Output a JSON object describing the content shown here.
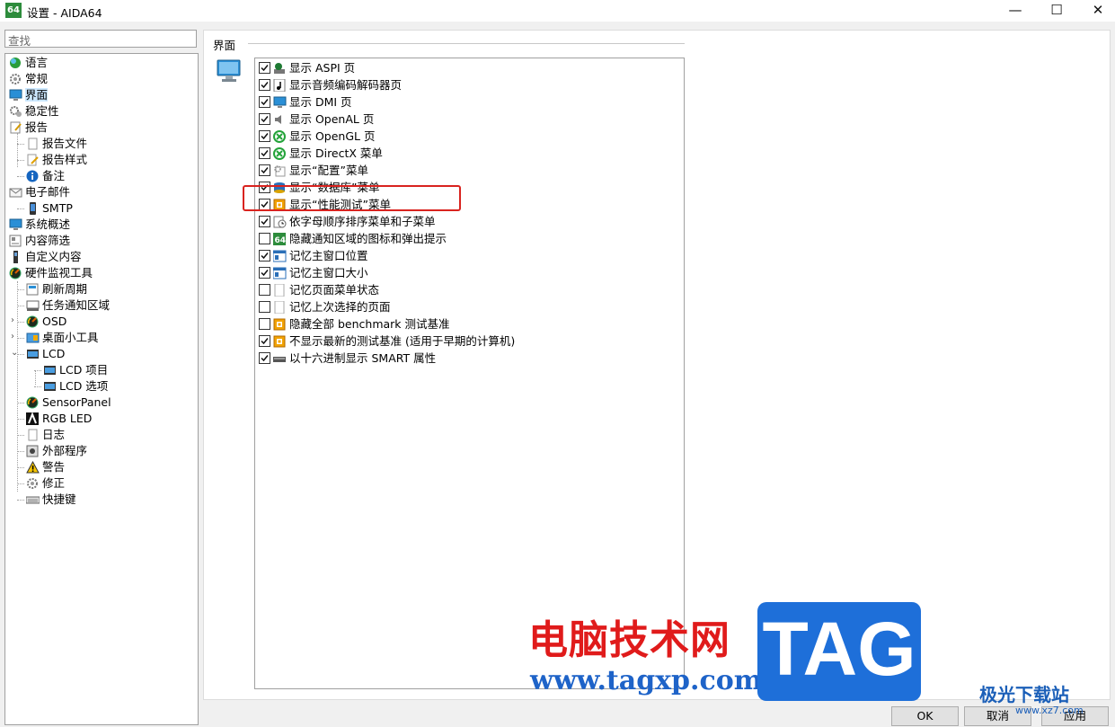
{
  "window": {
    "app_icon": "64",
    "title": "设置 - AIDA64",
    "controls": [
      "—",
      "☐",
      "✕"
    ]
  },
  "search": {
    "placeholder": "查找"
  },
  "tree": [
    {
      "label": "语言",
      "icon": "globe-icon",
      "level": 0
    },
    {
      "label": "常规",
      "icon": "gear-icon",
      "level": 0
    },
    {
      "label": "界面",
      "icon": "monitor-icon",
      "level": 0,
      "selected": true
    },
    {
      "label": "稳定性",
      "icon": "gears-icon",
      "level": 0
    },
    {
      "label": "报告",
      "icon": "report-icon",
      "level": 0
    },
    {
      "label": "报告文件",
      "icon": "file-icon",
      "level": 1
    },
    {
      "label": "报告样式",
      "icon": "pencil-file-icon",
      "level": 1
    },
    {
      "label": "备注",
      "icon": "info-icon",
      "level": 1
    },
    {
      "label": "电子邮件",
      "icon": "mail-icon",
      "level": 0
    },
    {
      "label": "SMTP",
      "icon": "phone-icon",
      "level": 1
    },
    {
      "label": "系统概述",
      "icon": "monitor-icon",
      "level": 0
    },
    {
      "label": "内容筛选",
      "icon": "filter-icon",
      "level": 0
    },
    {
      "label": "自定义内容",
      "icon": "device-icon",
      "level": 0
    },
    {
      "label": "硬件监视工具",
      "icon": "gauge-icon",
      "level": 0
    },
    {
      "label": "刷新周期",
      "icon": "refresh-icon",
      "level": 1
    },
    {
      "label": "任务通知区域",
      "icon": "tray-icon",
      "level": 1
    },
    {
      "label": "OSD",
      "icon": "gauge-icon",
      "level": 1,
      "expander": "›"
    },
    {
      "label": "桌面小工具",
      "icon": "widget-icon",
      "level": 1,
      "expander": "›"
    },
    {
      "label": "LCD",
      "icon": "lcd-icon",
      "level": 1,
      "expander": "⌄"
    },
    {
      "label": "LCD 项目",
      "icon": "lcd-icon",
      "level": 2
    },
    {
      "label": "LCD 选项",
      "icon": "lcd-icon",
      "level": 2
    },
    {
      "label": "SensorPanel",
      "icon": "gauge-icon",
      "level": 1
    },
    {
      "label": "RGB LED",
      "icon": "rgb-icon",
      "level": 1
    },
    {
      "label": "日志",
      "icon": "file-icon",
      "level": 1
    },
    {
      "label": "外部程序",
      "icon": "program-icon",
      "level": 1
    },
    {
      "label": "警告",
      "icon": "warning-icon",
      "level": 1
    },
    {
      "label": "修正",
      "icon": "gear-icon",
      "level": 1
    },
    {
      "label": "快捷键",
      "icon": "keyboard-icon",
      "level": 1
    }
  ],
  "section": {
    "title": "界面"
  },
  "options": [
    {
      "label": "显示 ASPI 页",
      "checked": true,
      "icon": "aspi-icon"
    },
    {
      "label": "显示音频编码解码器页",
      "checked": true,
      "icon": "music-icon"
    },
    {
      "label": "显示 DMI 页",
      "checked": true,
      "icon": "monitor-icon"
    },
    {
      "label": "显示 OpenAL 页",
      "checked": true,
      "icon": "speaker-icon"
    },
    {
      "label": "显示 OpenGL 页",
      "checked": true,
      "icon": "xbox-icon"
    },
    {
      "label": "显示 DirectX 菜单",
      "checked": true,
      "icon": "xbox-icon"
    },
    {
      "label": "显示“配置”菜单",
      "checked": true,
      "icon": "config-icon"
    },
    {
      "label": "显示“数据库”菜单",
      "checked": true,
      "icon": "database-icon"
    },
    {
      "label": "显示“性能测试”菜单",
      "checked": true,
      "icon": "benchmark-icon"
    },
    {
      "label": "依字母顺序排序菜单和子菜单",
      "checked": true,
      "icon": "sort-icon"
    },
    {
      "label": "隐藏通知区域的图标和弹出提示",
      "checked": false,
      "icon": "app64-icon"
    },
    {
      "label": "记忆主窗口位置",
      "checked": true,
      "icon": "window-icon"
    },
    {
      "label": "记忆主窗口大小",
      "checked": true,
      "icon": "window-icon"
    },
    {
      "label": "记忆页面菜单状态",
      "checked": false,
      "icon": "page-icon"
    },
    {
      "label": "记忆上次选择的页面",
      "checked": false,
      "icon": "page-icon"
    },
    {
      "label": "隐藏全部 benchmark 测试基准",
      "checked": false,
      "icon": "benchmark-icon"
    },
    {
      "label": "不显示最新的测试基准 (适用于早期的计算机)",
      "checked": true,
      "icon": "benchmark-icon"
    },
    {
      "label": "以十六进制显示 SMART 属性",
      "checked": true,
      "icon": "drive-icon"
    }
  ],
  "buttons": {
    "ok": "OK",
    "cancel": "取消",
    "apply": "应用"
  },
  "watermark": {
    "brand_cn": "电脑技术网",
    "url": "www.tagxp.com",
    "tag": "TAG",
    "site2": "极光下载站",
    "site2_url": "www.xz7.com"
  },
  "colors": {
    "highlight": "#d9231f",
    "selection": "#cce8ff",
    "tag_blue": "#1e6fd9",
    "brand_red": "#e01b1b"
  }
}
